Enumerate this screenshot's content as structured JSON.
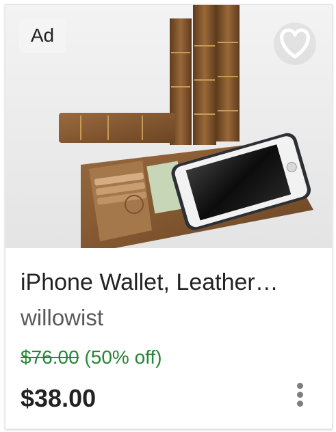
{
  "listing": {
    "ad_label": "Ad",
    "favorite_icon": "heart-outline-icon",
    "title": "iPhone Wallet, Leather…",
    "shop": "willowist",
    "original_price": "$76.00",
    "discount": "(50% off)",
    "price": "$38.00",
    "more_icon": "kebab-menu-icon"
  },
  "colors": {
    "sale_green": "#258635",
    "text_dark": "#222222",
    "text_muted": "#595959"
  }
}
